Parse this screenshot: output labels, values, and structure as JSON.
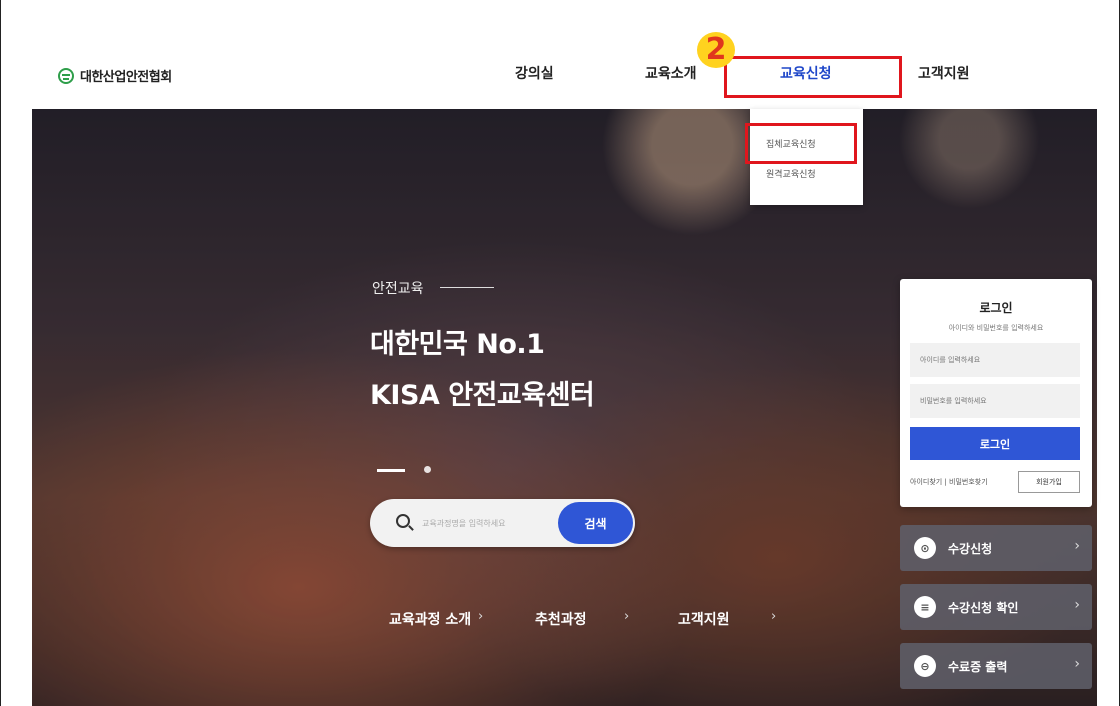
{
  "header": {
    "logo_text": "대한산업안전협회",
    "nav": [
      "강의실",
      "교육소개",
      "교육신청",
      "고객지원"
    ]
  },
  "annotation": {
    "marker": "2"
  },
  "dropdown": {
    "items": [
      "집체교육신청",
      "원격교육신청"
    ]
  },
  "hero": {
    "kicker": "안전교육",
    "title_line1": "대한민국 No.1",
    "title_line2": "KISA 안전교육센터"
  },
  "search": {
    "placeholder": "교육과정명을 입력하세요",
    "button": "검색"
  },
  "quick_links": [
    {
      "label": "교육과정 소개",
      "arrow": "›"
    },
    {
      "label": "추천과정",
      "arrow": "›"
    },
    {
      "label": "고객지원",
      "arrow": "›"
    }
  ],
  "login": {
    "title": "로그인",
    "subtitle": "아이디와 비밀번호를 입력하세요",
    "id_placeholder": "아이디를 입력하세요",
    "pw_placeholder": "비밀번호를 입력하세요",
    "button": "로그인",
    "find_links": "아이디찾기 | 비밀번호찾기",
    "signup": "회원가입"
  },
  "quick_menu": [
    {
      "label": "수강신청",
      "icon_char": "⊙",
      "icon": "enroll-icon",
      "arrow": "›"
    },
    {
      "label": "수강신청 확인",
      "icon_char": "≡",
      "icon": "list-icon",
      "arrow": "›"
    },
    {
      "label": "수료증 출력",
      "icon_char": "⊖",
      "icon": "print-icon",
      "arrow": "›"
    }
  ],
  "colors": {
    "accent": "#2f56d6",
    "highlight_box": "#e0161d",
    "marker_bg": "#ffd21f",
    "nav_active": "#1f47c9"
  }
}
